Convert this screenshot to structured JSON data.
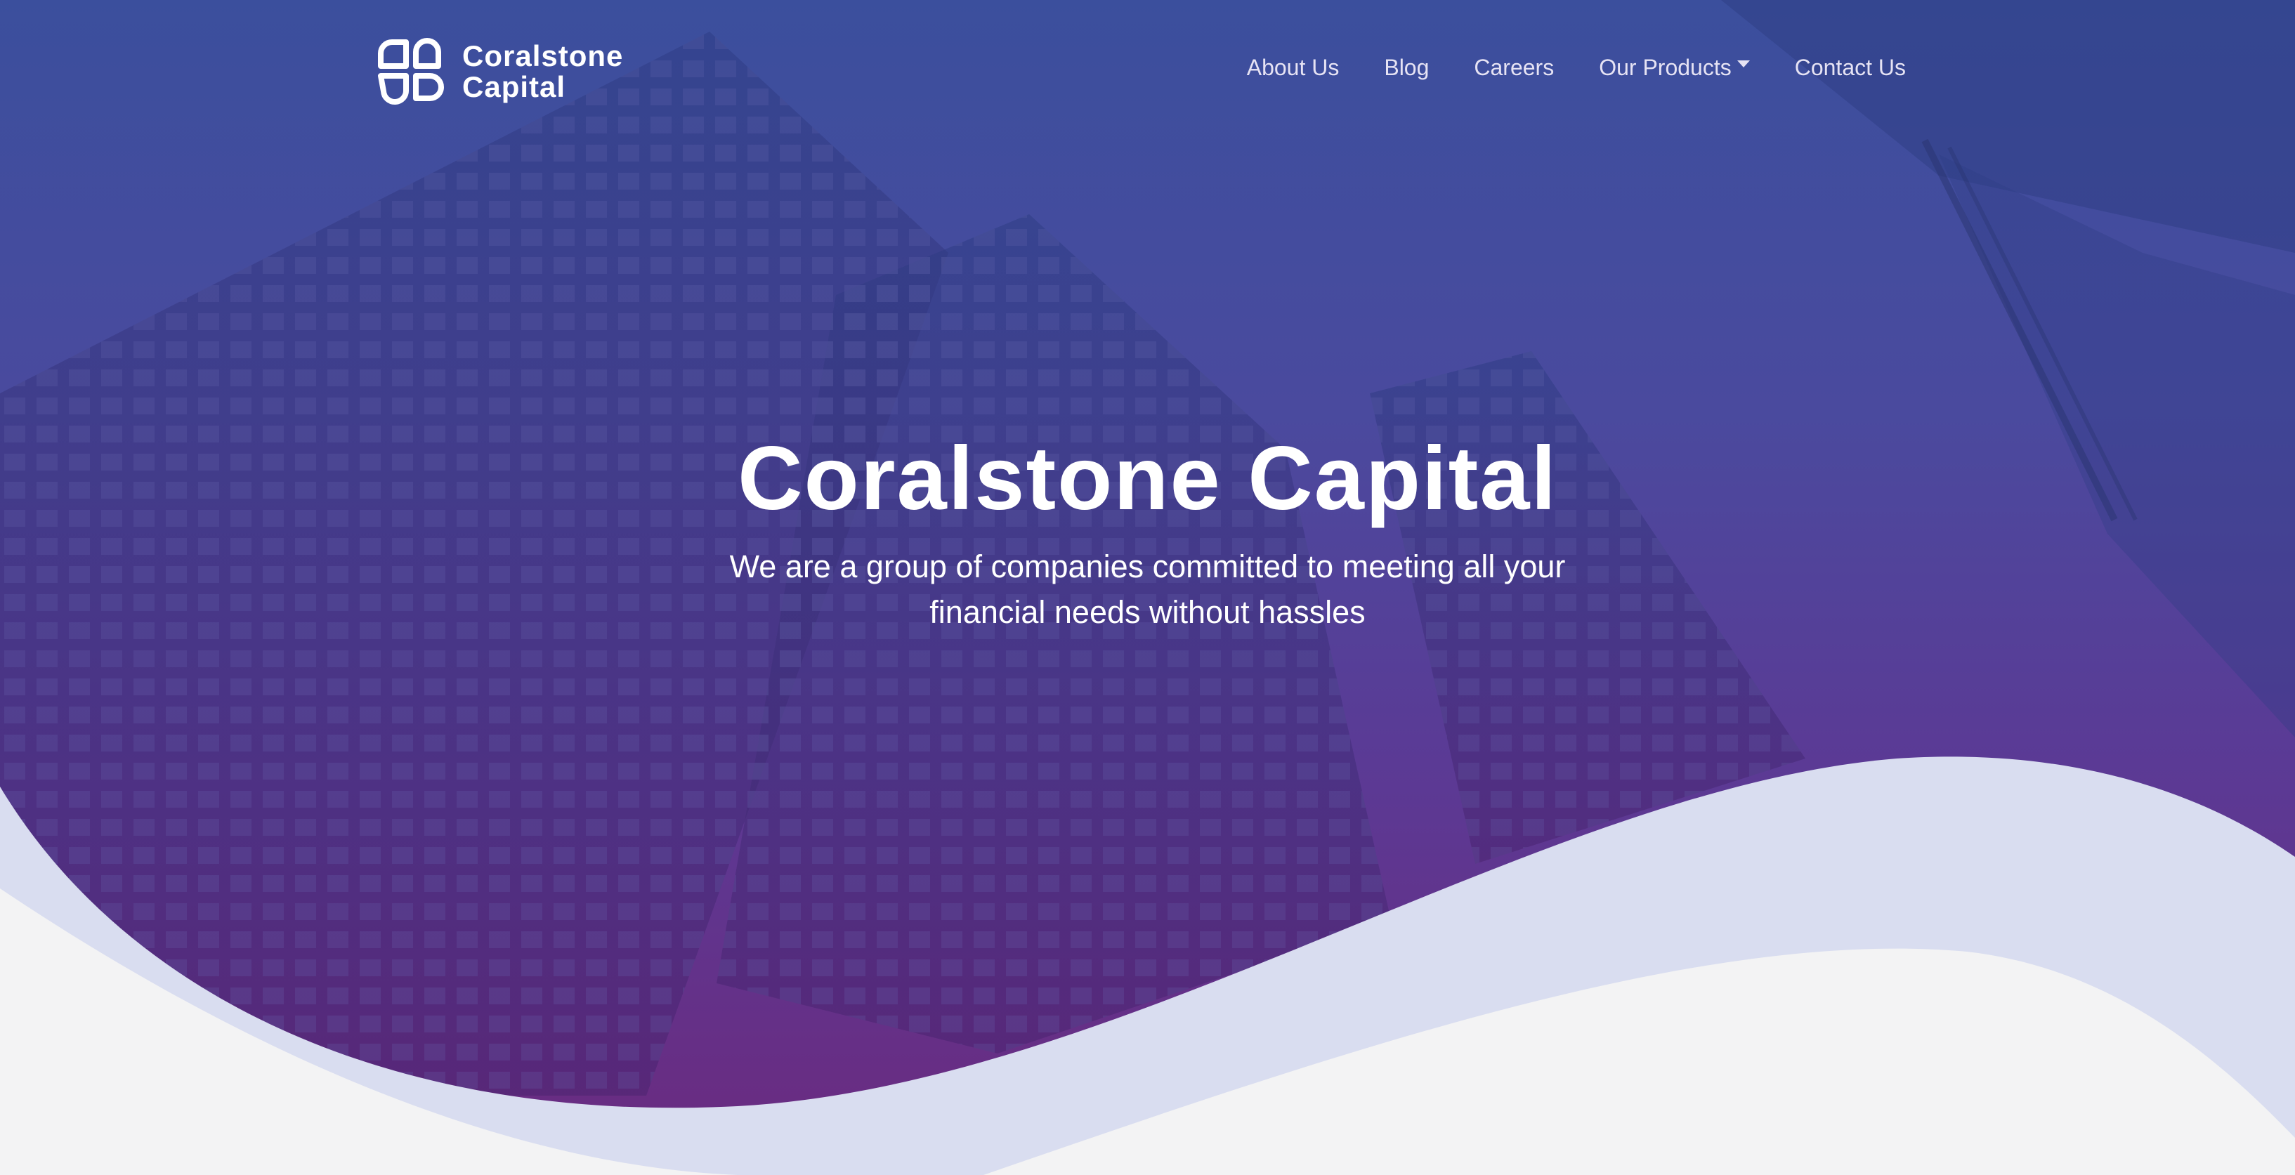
{
  "brand": {
    "name_line1": "Coralstone",
    "name_line2": "Capital",
    "logo_icon": "clover-logo-icon"
  },
  "nav": {
    "items": [
      {
        "label": "About Us"
      },
      {
        "label": "Blog"
      },
      {
        "label": "Careers"
      },
      {
        "label": "Our Products",
        "has_dropdown": true
      },
      {
        "label": "Contact Us"
      }
    ]
  },
  "hero": {
    "title": "Coralstone Capital",
    "subtitle": "We are a group of companies committed to meeting all your financial needs without hassles"
  },
  "colors": {
    "gradient_top": "#3d4f9c",
    "gradient_mid": "#55449b",
    "gradient_bottom": "#6a2d84",
    "wave_light": "#d9ddf0",
    "page_bg": "#f3f3f4",
    "nav_text": "#e6e3f4"
  }
}
